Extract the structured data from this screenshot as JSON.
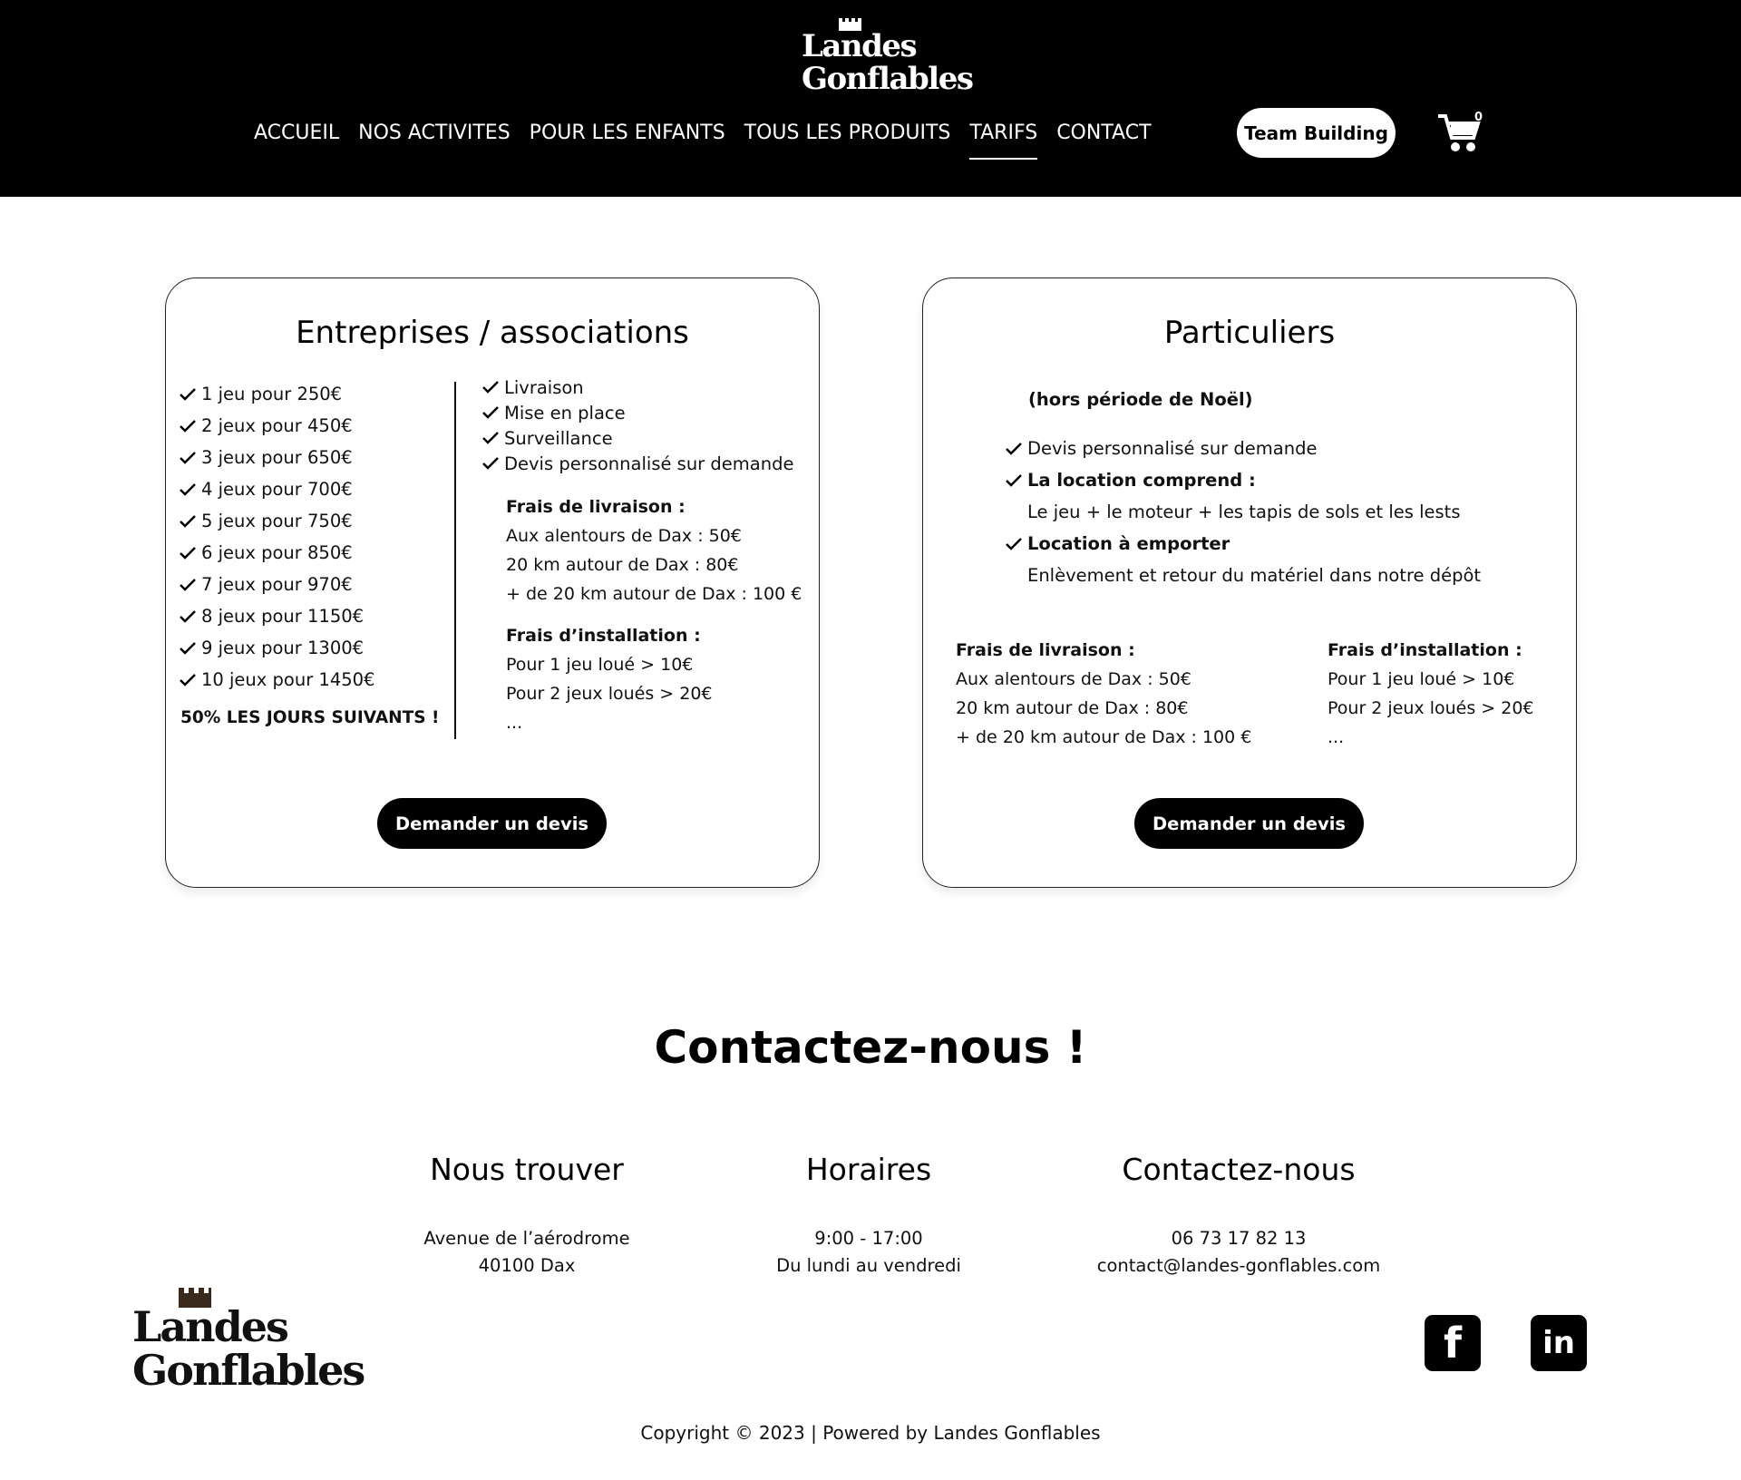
{
  "brand": {
    "logo_line1": "Landes",
    "logo_line2": "Gonflables"
  },
  "nav": {
    "items": [
      "ACCUEIL",
      "NOS ACTIVITES",
      "POUR LES ENFANTS",
      "TOUS LES PRODUITS",
      "TARIFS",
      "CONTACT"
    ],
    "active": "TARIFS",
    "team_building": "Team Building",
    "cart_count": "0"
  },
  "entreprises": {
    "title": "Entreprises / associations",
    "prices": [
      "1 jeu pour 250€",
      "2 jeux pour 450€",
      "3 jeux pour 650€",
      "4 jeux pour 700€",
      "5 jeux pour 750€",
      "6 jeux pour 850€",
      "7 jeux pour 970€",
      "8 jeux pour 1150€",
      "9 jeux pour 1300€",
      "10 jeux pour 1450€"
    ],
    "promo": "50% LES JOURS SUIVANTS !",
    "includes": [
      "Livraison",
      "Mise en place",
      "Surveillance",
      "Devis personnalisé sur demande"
    ],
    "delivery_title": "Frais de livraison :",
    "delivery": [
      "Aux alentours de Dax : 50€",
      "20 km autour de Dax : 80€",
      "+ de 20 km autour de Dax : 100 €"
    ],
    "install_title": "Frais d’installation :",
    "install": [
      "Pour 1 jeu loué > 10€",
      "Pour 2 jeux loués > 20€",
      "..."
    ],
    "button": "Demander un devis"
  },
  "particuliers": {
    "title": "Particuliers",
    "note": "(hors période de Noël)",
    "item1": "Devis personnalisé sur demande",
    "item2": "La location comprend :",
    "item2_detail": "Le jeu + le moteur + les tapis de sols et les lests",
    "item3": "Location à emporter",
    "item3_detail": "Enlèvement et retour du matériel dans notre dépôt",
    "delivery_title": "Frais de livraison :",
    "delivery": [
      "Aux alentours de Dax : 50€",
      "20 km autour de Dax : 80€",
      "+ de 20 km autour de Dax : 100 €"
    ],
    "install_title": "Frais d’installation :",
    "install": [
      "Pour 1 jeu loué > 10€",
      "Pour 2 jeux loués > 20€",
      "..."
    ],
    "button": "Demander un devis"
  },
  "contact": {
    "title": "Contactez-nous !",
    "find": {
      "heading": "Nous trouver",
      "line1": "Avenue de l’aérodrome",
      "line2": "40100 Dax"
    },
    "hours": {
      "heading": "Horaires",
      "line1": "9:00 - 17:00",
      "line2": "Du lundi au vendredi"
    },
    "reach": {
      "heading": "Contactez-nous",
      "line1": "06 73 17 82 13",
      "line2": "contact@landes-gonflables.com"
    }
  },
  "social": {
    "facebook": "f",
    "linkedin": "in"
  },
  "footer": {
    "copyright": "Copyright © 2023 | Powered by Landes Gonflables"
  }
}
